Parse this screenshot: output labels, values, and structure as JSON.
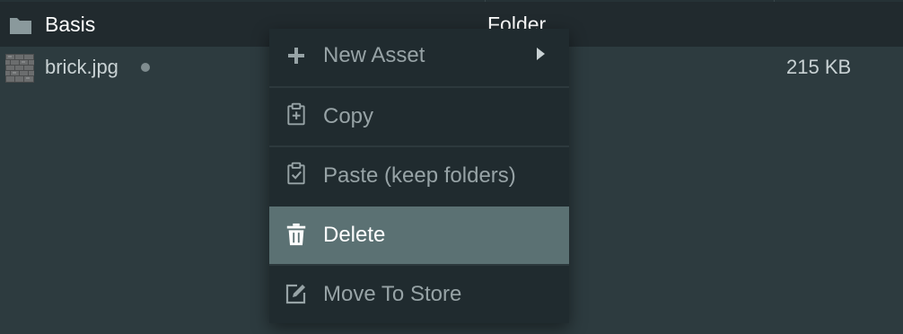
{
  "folder": {
    "name": "Basis",
    "type": "Folder",
    "icon": "folder-icon"
  },
  "file": {
    "name": "brick.jpg",
    "size": "215 KB",
    "thumbnail": "brick-texture-thumbnail",
    "unsaved_indicator": "dot"
  },
  "context_menu": {
    "items": [
      {
        "label": "New Asset",
        "icon": "plus-icon",
        "has_submenu": true
      },
      {
        "label": "Copy",
        "icon": "clipboard-plus-icon"
      },
      {
        "label": "Paste (keep folders)",
        "icon": "clipboard-check-icon"
      },
      {
        "label": "Delete",
        "icon": "trash-icon",
        "highlighted": true
      },
      {
        "label": "Move To Store",
        "icon": "edit-square-icon"
      }
    ]
  },
  "colors": {
    "background": "#2d3b3f",
    "header_bg": "#212a2e",
    "menu_bg": "#202b2f",
    "menu_highlight": "#5b7173",
    "menu_text": "#97a3a6",
    "text_white": "#ffffff"
  }
}
